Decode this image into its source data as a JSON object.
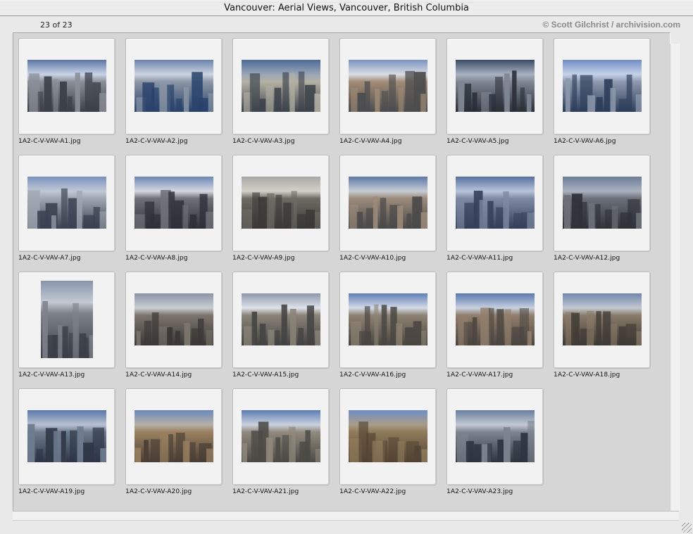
{
  "window": {
    "title": "Vancouver: Aerial Views, Vancouver, British Columbia"
  },
  "header": {
    "count": "23 of 23",
    "copyright": "© Scott Gilchrist / archivision.com"
  },
  "thumbnails": [
    {
      "filename": "1A2-C-V-VAV-A1.jpg",
      "orientation": "landscape",
      "palette": [
        "#5b76a6",
        "#c9d3e6",
        "#3b3f48",
        "#8a8f98"
      ]
    },
    {
      "filename": "1A2-C-V-VAV-A2.jpg",
      "orientation": "landscape",
      "palette": [
        "#6a83ad",
        "#cdd5e2",
        "#29426b",
        "#8c97a6"
      ]
    },
    {
      "filename": "1A2-C-V-VAV-A3.jpg",
      "orientation": "landscape",
      "palette": [
        "#4e6b96",
        "#9aa6b6",
        "#3d434c",
        "#b4b1a3"
      ]
    },
    {
      "filename": "1A2-C-V-VAV-A4.jpg",
      "orientation": "landscape",
      "palette": [
        "#7a92c0",
        "#d9dde4",
        "#4c4c4e",
        "#a18b76"
      ]
    },
    {
      "filename": "1A2-C-V-VAV-A5.jpg",
      "orientation": "landscape",
      "palette": [
        "#384a63",
        "#a9b2c2",
        "#2a2f38",
        "#7f8793"
      ]
    },
    {
      "filename": "1A2-C-V-VAV-A6.jpg",
      "orientation": "landscape",
      "palette": [
        "#6f8ec4",
        "#c5d2e8",
        "#2e3e5a",
        "#8d99ad"
      ]
    },
    {
      "filename": "1A2-C-V-VAV-A7.jpg",
      "orientation": "landscape",
      "palette": [
        "#7b92bd",
        "#c0c8d4",
        "#3a4150",
        "#9fa7b2"
      ]
    },
    {
      "filename": "1A2-C-V-VAV-A8.jpg",
      "orientation": "landscape",
      "palette": [
        "#6d86b6",
        "#d4d8e0",
        "#2e3038",
        "#6f7078"
      ]
    },
    {
      "filename": "1A2-C-V-VAV-A9.jpg",
      "orientation": "landscape",
      "palette": [
        "#a7a8a6",
        "#d3d0c7",
        "#3a3937",
        "#6e6b64"
      ]
    },
    {
      "filename": "1A2-C-V-VAV-A10.jpg",
      "orientation": "landscape",
      "palette": [
        "#5d78a8",
        "#c5cbd2",
        "#4a4a4a",
        "#9b8a7a"
      ]
    },
    {
      "filename": "1A2-C-V-VAV-A11.jpg",
      "orientation": "landscape",
      "palette": [
        "#56709f",
        "#b9c4d8",
        "#34405a",
        "#7e8aa3"
      ]
    },
    {
      "filename": "1A2-C-V-VAV-A12.jpg",
      "orientation": "landscape",
      "palette": [
        "#6c7d96",
        "#aab2bf",
        "#2f3339",
        "#6c7077"
      ]
    },
    {
      "filename": "1A2-C-V-VAV-A13.jpg",
      "orientation": "portrait",
      "palette": [
        "#8795aa",
        "#c3c9d2",
        "#3b3f47",
        "#7e828a"
      ]
    },
    {
      "filename": "1A2-C-V-VAV-A14.jpg",
      "orientation": "landscape",
      "palette": [
        "#8b95a6",
        "#c9cdd2",
        "#3a3836",
        "#7b756c"
      ]
    },
    {
      "filename": "1A2-C-V-VAV-A15.jpg",
      "orientation": "landscape",
      "palette": [
        "#8c98ad",
        "#dfe3ea",
        "#434343",
        "#8a8478"
      ]
    },
    {
      "filename": "1A2-C-V-VAV-A16.jpg",
      "orientation": "landscape",
      "palette": [
        "#5f7fb8",
        "#d3dae6",
        "#4a4641",
        "#8d8273"
      ]
    },
    {
      "filename": "1A2-C-V-VAV-A17.jpg",
      "orientation": "landscape",
      "palette": [
        "#5a78b0",
        "#c7d0de",
        "#4b4540",
        "#927f6d"
      ]
    },
    {
      "filename": "1A2-C-V-VAV-A18.jpg",
      "orientation": "landscape",
      "palette": [
        "#6f86ad",
        "#c3c9d1",
        "#3e3a35",
        "#8a7b69"
      ]
    },
    {
      "filename": "1A2-C-V-VAV-A19.jpg",
      "orientation": "landscape",
      "palette": [
        "#5b77aa",
        "#b7c1d2",
        "#2f3746",
        "#6f7c8f"
      ]
    },
    {
      "filename": "1A2-C-V-VAV-A20.jpg",
      "orientation": "landscape",
      "palette": [
        "#6b89bd",
        "#b6b0a6",
        "#4a3f36",
        "#9a8060"
      ]
    },
    {
      "filename": "1A2-C-V-VAV-A21.jpg",
      "orientation": "landscape",
      "palette": [
        "#5d7cb4",
        "#c9d1dd",
        "#4b4a46",
        "#91897c"
      ]
    },
    {
      "filename": "1A2-C-V-VAV-A22.jpg",
      "orientation": "landscape",
      "palette": [
        "#6f8fc5",
        "#a99c88",
        "#524434",
        "#8f7a5a"
      ]
    },
    {
      "filename": "1A2-C-V-VAV-A23.jpg",
      "orientation": "landscape",
      "palette": [
        "#6a7e9e",
        "#c2c9d2",
        "#2f3540",
        "#7d8590"
      ]
    }
  ]
}
